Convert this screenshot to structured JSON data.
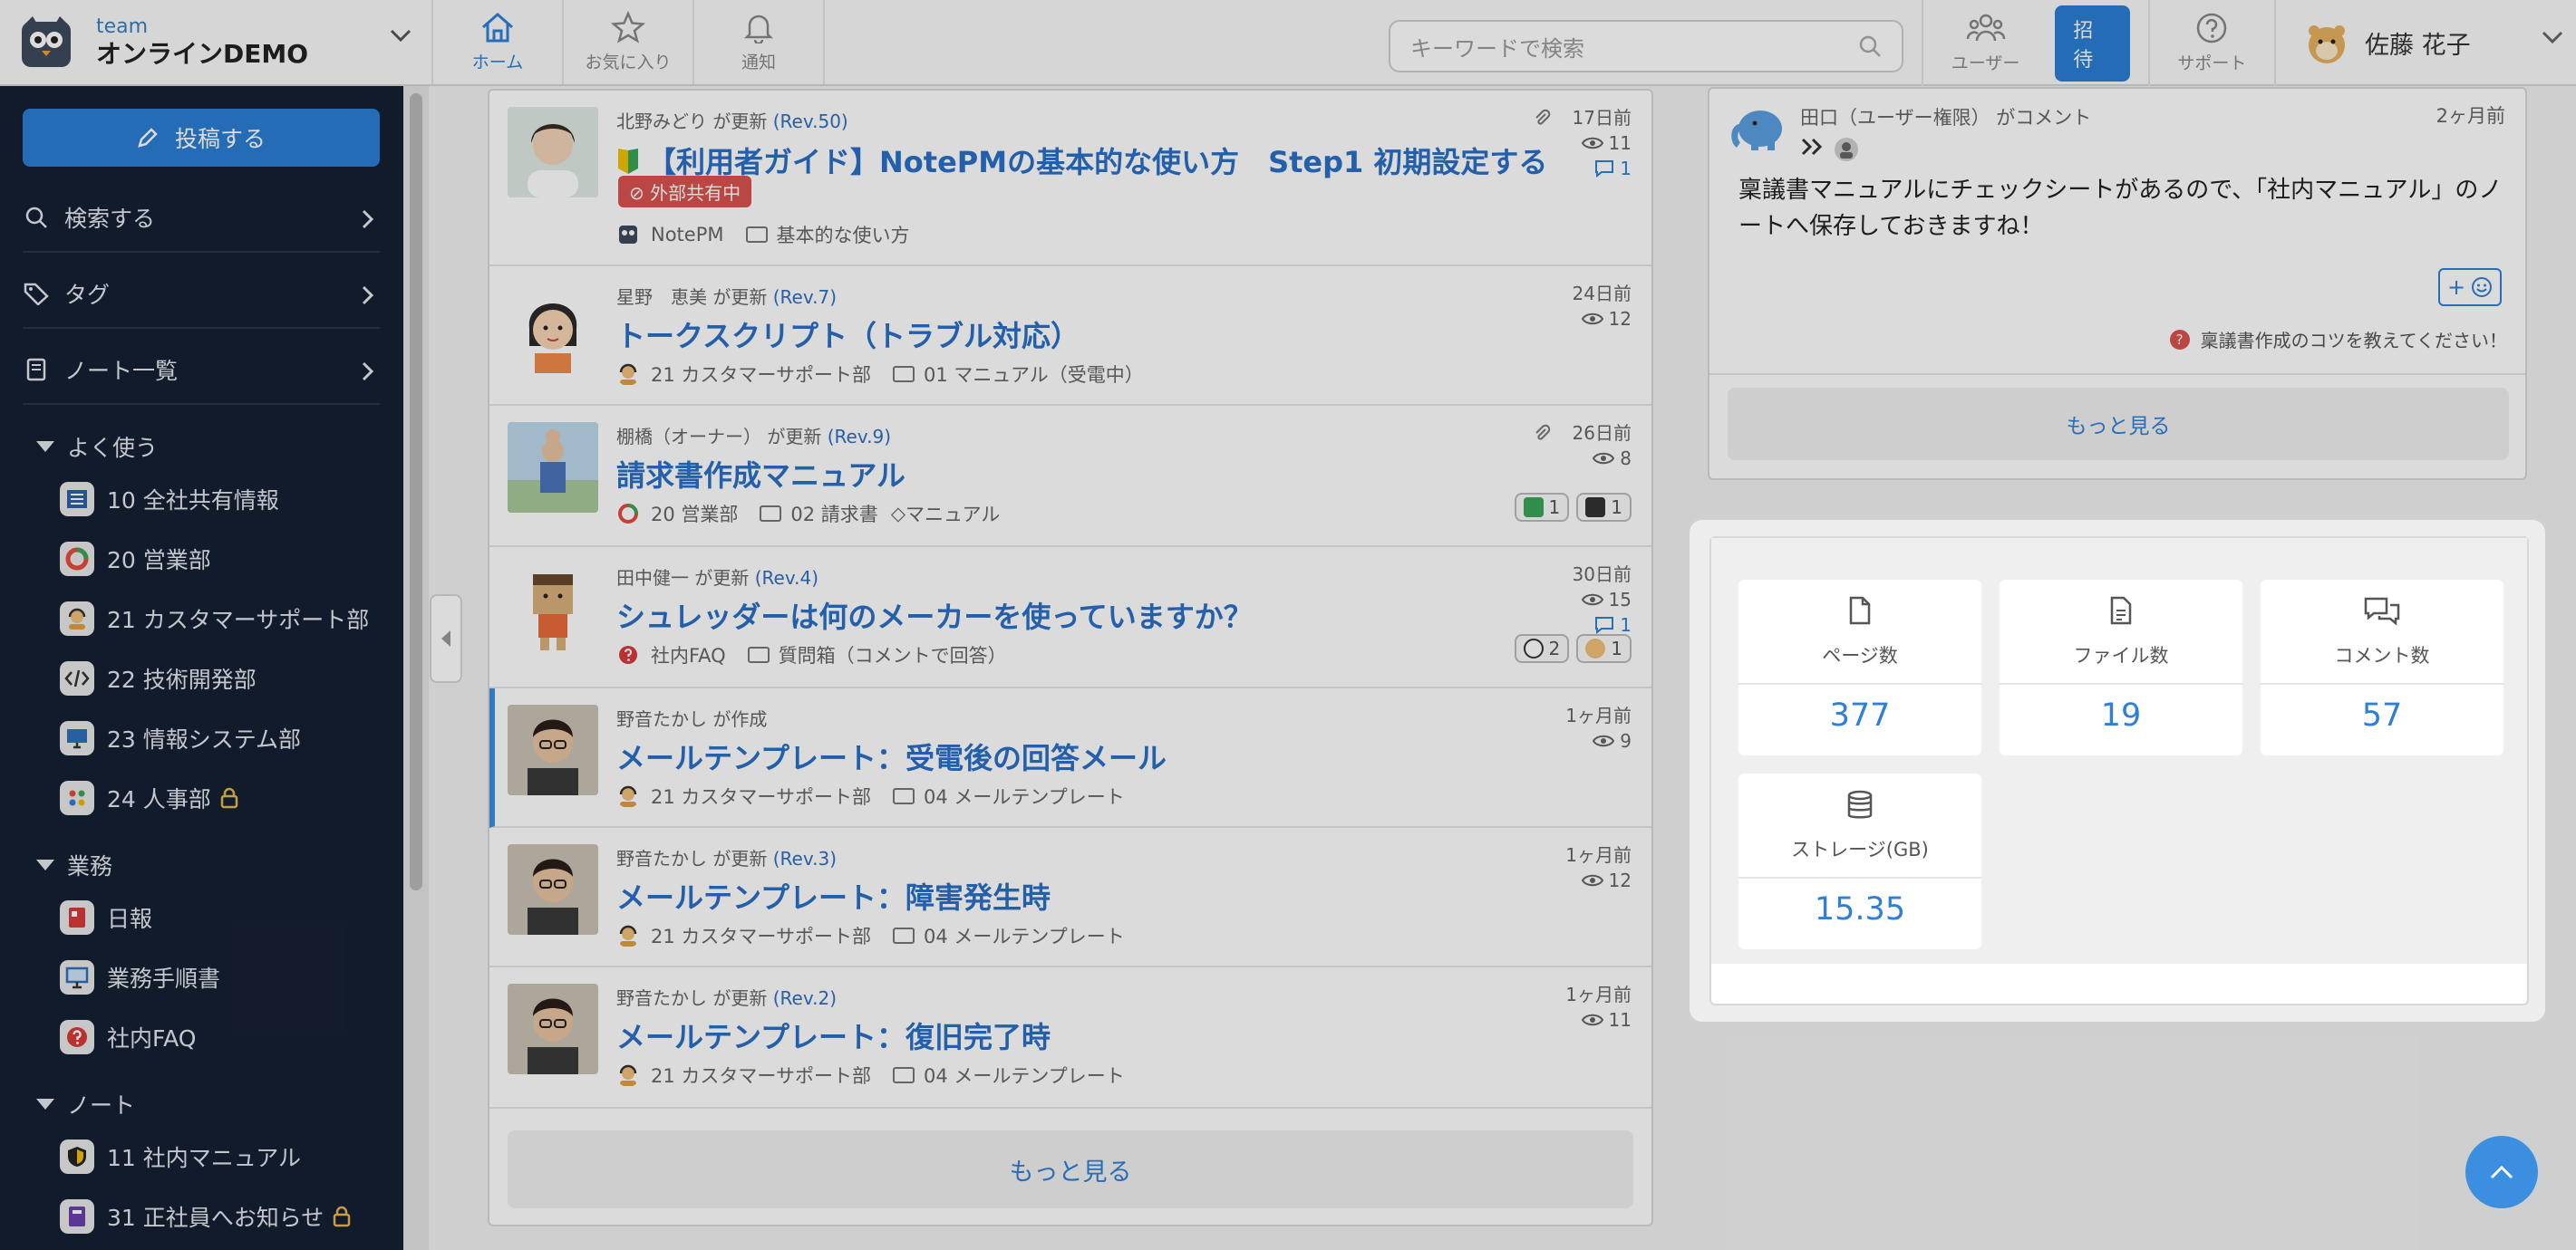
{
  "header": {
    "team_small": "team",
    "team_name": "オンラインDEMO",
    "nav": [
      {
        "label": "ホーム",
        "icon": "home-icon"
      },
      {
        "label": "お気に入り",
        "icon": "star-icon"
      },
      {
        "label": "通知",
        "icon": "bell-icon"
      }
    ],
    "search_placeholder": "キーワードで検索",
    "users_label": "ユーザー",
    "invite_label": "招待",
    "support_label": "サポート",
    "user_name": "佐藤 花子"
  },
  "sidebar": {
    "post_label": "投稿する",
    "nav_rows": [
      {
        "label": "検索する",
        "icon": "search-icon"
      },
      {
        "label": "タグ",
        "icon": "tag-icon"
      },
      {
        "label": "ノート一覧",
        "icon": "book-icon"
      }
    ],
    "sections": [
      {
        "label": "よく使う",
        "items": [
          {
            "label": "10 全社共有情報",
            "locked": false
          },
          {
            "label": "20 営業部",
            "locked": false
          },
          {
            "label": "21 カスタマーサポート部",
            "locked": false
          },
          {
            "label": "22 技術開発部",
            "locked": false
          },
          {
            "label": "23 情報システム部",
            "locked": false
          },
          {
            "label": "24 人事部",
            "locked": true
          }
        ]
      },
      {
        "label": "業務",
        "items": [
          {
            "label": "日報",
            "locked": false
          },
          {
            "label": "業務手順書",
            "locked": false
          },
          {
            "label": "社内FAQ",
            "locked": false
          }
        ]
      },
      {
        "label": "ノート",
        "items": [
          {
            "label": "11 社内マニュアル",
            "locked": false
          },
          {
            "label": "31 正社員へお知らせ",
            "locked": true
          }
        ]
      }
    ]
  },
  "feed": {
    "items": [
      {
        "user_action": "北野みどり が更新",
        "rev": "(Rev.50)",
        "title": "【利用者ガイド】NotePMの基本的な使い方　Step1 初期設定する",
        "badge": "外部共有中",
        "note": "NotePM",
        "folder": "基本的な使い方",
        "tag": "",
        "time": "17日前",
        "views": "11",
        "comments": "1",
        "attachment": true
      },
      {
        "user_action": "星野　恵美 が更新",
        "rev": "(Rev.7)",
        "title": "トークスクリプト（トラブル対応）",
        "badge": "",
        "note": "21 カスタマーサポート部",
        "folder": "01 マニュアル（受電中）",
        "tag": "",
        "time": "24日前",
        "views": "12",
        "comments": "",
        "attachment": false
      },
      {
        "user_action": "棚橋（オーナー） が更新",
        "rev": "(Rev.9)",
        "title": "請求書作成マニュアル",
        "badge": "",
        "note": "20 営業部",
        "folder": "02 請求書",
        "tag": "マニュアル",
        "time": "26日前",
        "views": "8",
        "comments": "",
        "attachment": true,
        "reactions": [
          "1",
          "1"
        ]
      },
      {
        "user_action": "田中健一 が更新",
        "rev": "(Rev.4)",
        "title": "シュレッダーは何のメーカーを使っていますか？",
        "badge": "",
        "note": "社内FAQ",
        "folder": "質問箱（コメントで回答）",
        "tag": "",
        "time": "30日前",
        "views": "15",
        "comments": "1",
        "attachment": false,
        "reactions": [
          "2",
          "1"
        ]
      },
      {
        "user_action": "野音たかし が作成",
        "rev": "",
        "title": "メールテンプレート：受電後の回答メール",
        "badge": "",
        "note": "21 カスタマーサポート部",
        "folder": "04 メールテンプレート",
        "tag": "",
        "time": "1ヶ月前",
        "views": "9",
        "comments": "",
        "attachment": false
      },
      {
        "user_action": "野音たかし が更新",
        "rev": "(Rev.3)",
        "title": "メールテンプレート：障害発生時",
        "badge": "",
        "note": "21 カスタマーサポート部",
        "folder": "04 メールテンプレート",
        "tag": "",
        "time": "1ヶ月前",
        "views": "12",
        "comments": "",
        "attachment": false
      },
      {
        "user_action": "野音たかし が更新",
        "rev": "(Rev.2)",
        "title": "メールテンプレート：復旧完了時",
        "badge": "",
        "note": "21 カスタマーサポート部",
        "folder": "04 メールテンプレート",
        "tag": "",
        "time": "1ヶ月前",
        "views": "11",
        "comments": "",
        "attachment": false
      }
    ],
    "more_label": "もっと見る"
  },
  "comment": {
    "author": "田口（ユーザー権限） がコメント",
    "time": "2ヶ月前",
    "body": "稟議書マニュアルにチェックシートがあるので、「社内マニュアル」のノートへ保存しておきますね！",
    "emoji_btn": "+",
    "ref": "稟議書作成のコツを教えてください！",
    "more_label": "もっと見る"
  },
  "stats": [
    {
      "label": "ページ数",
      "value": "377",
      "icon": "page-icon"
    },
    {
      "label": "ファイル数",
      "value": "19",
      "icon": "file-icon"
    },
    {
      "label": "コメント数",
      "value": "57",
      "icon": "comments-icon"
    },
    {
      "label": "ストレージ(GB)",
      "value": "15.35",
      "icon": "database-icon"
    }
  ],
  "colors": {
    "accent": "#2f7fd6",
    "sidebar": "#162033",
    "badge": "#d9534f"
  }
}
